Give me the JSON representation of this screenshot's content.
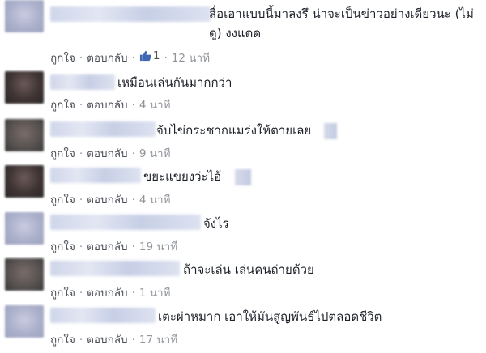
{
  "actions": {
    "like": "ถูกใจ",
    "reply": "ตอบกลับ",
    "separator": "·"
  },
  "comments": [
    {
      "text": "สื่อเอาแบบนี้มาลงรึ น่าจะเป็นข่าวอย่างเดียวนะ (ไม่ดู) งงแดด",
      "likes": "1",
      "time": "12 นาที"
    },
    {
      "text": "เหมือนเล่นกันมากกว่า",
      "time": "4 นาที"
    },
    {
      "text": "จับไข่กระชากแมร่งให้ตายเลย",
      "time": "9 นาที"
    },
    {
      "text": "ขยะแขยงว่ะไอ้",
      "time": "4 นาที"
    },
    {
      "text": "จังไร",
      "time": "19 นาที"
    },
    {
      "text": "ถ้าจะเล่น เล่นคนถ่ายด้วย",
      "time": "1 นาที"
    },
    {
      "text": "เตะผ่าหมาก เอาให้มันสูญพันธ์ไปตลอดชีวิต",
      "time": "17 นาที"
    }
  ],
  "icons": {
    "like": "thumbs-up-icon"
  },
  "colors": {
    "link": "#4267b2",
    "meta": "#90949c",
    "text": "#1d2129"
  }
}
